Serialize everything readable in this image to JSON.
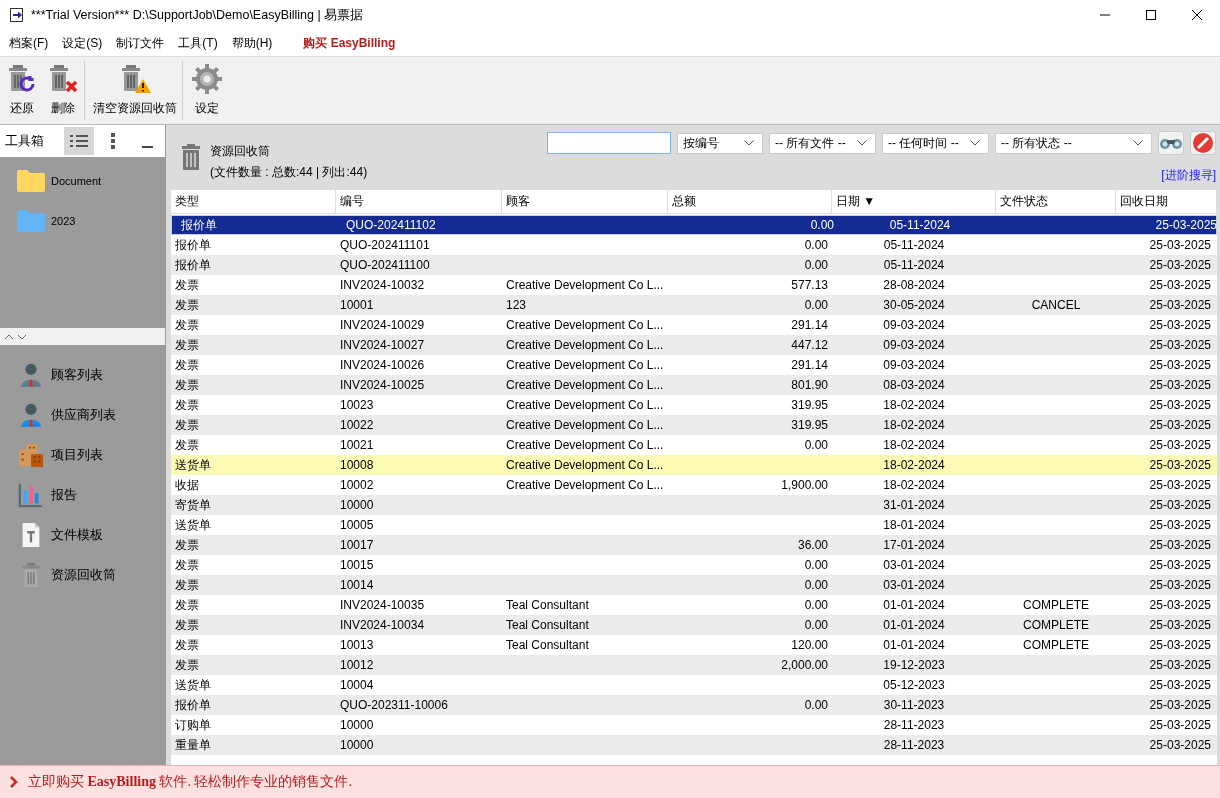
{
  "window": {
    "title": "***Trial Version*** D:\\SupportJob\\Demo\\EasyBilling | 易票据"
  },
  "menu": [
    "档案(F)",
    "设定(S)",
    "制订文件",
    "工具(T)",
    "帮助(H)"
  ],
  "buy_link": "购买 EasyBilling",
  "toolbar": [
    {
      "label": "还原",
      "kind": "restore"
    },
    {
      "label": "删除",
      "kind": "delete"
    },
    {
      "label": "清空资源回收筒",
      "kind": "empty"
    },
    {
      "label": "设定",
      "kind": "settings"
    }
  ],
  "toolbox": {
    "title": "工具箱",
    "views": [
      {
        "kind": "list",
        "selected": true
      },
      {
        "kind": "dots",
        "selected": false
      }
    ],
    "folders": [
      {
        "name": "Document",
        "color": "#ffd75e"
      },
      {
        "name": "2023",
        "color": "#64b5f6"
      }
    ],
    "nav": [
      {
        "label": "顾客列表",
        "kind": "customer"
      },
      {
        "label": "供应商列表",
        "kind": "supplier"
      },
      {
        "label": "项目列表",
        "kind": "project"
      },
      {
        "label": "报告",
        "kind": "report"
      },
      {
        "label": "文件模板",
        "kind": "template"
      },
      {
        "label": "资源回收筒",
        "kind": "bin"
      }
    ]
  },
  "panel": {
    "title": "资源回收筒",
    "count": "(文件数量 : 总数:44 | 列出:44)",
    "filters": [
      "按编号",
      "-- 所有文件 --",
      "-- 任何时间 --",
      "-- 所有状态 --"
    ],
    "advanced_link": "[进阶搜寻]"
  },
  "table": {
    "columns": [
      "类型",
      "编号",
      "顾客",
      "总额",
      "日期 ▼",
      "文件状态",
      "回收日期"
    ],
    "rows": [
      {
        "type": "报价单",
        "number": "QUO-202411102",
        "amount": "0.00",
        "date": "05-11-2024",
        "recycled": "25-03-2025",
        "selected": true,
        "highlighted": false
      },
      {
        "type": "报价单",
        "number": "QUO-202411101",
        "amount": "0.00",
        "date": "05-11-2024",
        "recycled": "25-03-2025",
        "selected": false,
        "highlighted": false
      },
      {
        "type": "报价单",
        "number": "QUO-202411100",
        "amount": "0.00",
        "date": "05-11-2024",
        "recycled": "25-03-2025",
        "selected": false,
        "highlighted": false
      },
      {
        "type": "发票",
        "number": "INV2024-10032",
        "customer": "Creative Development Co L...",
        "amount": "577.13",
        "date": "28-08-2024",
        "recycled": "25-03-2025",
        "selected": false,
        "highlighted": false
      },
      {
        "type": "发票",
        "number": "10001",
        "customer": "123",
        "amount": "0.00",
        "date": "30-05-2024",
        "status": "CANCEL",
        "recycled": "25-03-2025",
        "selected": false,
        "highlighted": false
      },
      {
        "type": "发票",
        "number": "INV2024-10029",
        "customer": "Creative Development Co L...",
        "amount": "291.14",
        "date": "09-03-2024",
        "recycled": "25-03-2025",
        "selected": false,
        "highlighted": false
      },
      {
        "type": "发票",
        "number": "INV2024-10027",
        "customer": "Creative Development Co L...",
        "amount": "447.12",
        "date": "09-03-2024",
        "recycled": "25-03-2025",
        "selected": false,
        "highlighted": false
      },
      {
        "type": "发票",
        "number": "INV2024-10026",
        "customer": "Creative Development Co L...",
        "amount": "291.14",
        "date": "09-03-2024",
        "recycled": "25-03-2025",
        "selected": false,
        "highlighted": false
      },
      {
        "type": "发票",
        "number": "INV2024-10025",
        "customer": "Creative Development Co L...",
        "amount": "801.90",
        "date": "08-03-2024",
        "recycled": "25-03-2025",
        "selected": false,
        "highlighted": false
      },
      {
        "type": "发票",
        "number": "10023",
        "customer": "Creative Development Co L...",
        "amount": "319.95",
        "date": "18-02-2024",
        "recycled": "25-03-2025",
        "selected": false,
        "highlighted": false
      },
      {
        "type": "发票",
        "number": "10022",
        "customer": "Creative Development Co L...",
        "amount": "319.95",
        "date": "18-02-2024",
        "recycled": "25-03-2025",
        "selected": false,
        "highlighted": false
      },
      {
        "type": "发票",
        "number": "10021",
        "customer": "Creative Development Co L...",
        "amount": "0.00",
        "date": "18-02-2024",
        "recycled": "25-03-2025",
        "selected": false,
        "highlighted": false
      },
      {
        "type": "送货单",
        "number": "10008",
        "customer": "Creative Development Co L...",
        "date": "18-02-2024",
        "recycled": "25-03-2025",
        "selected": false,
        "highlighted": true
      },
      {
        "type": "收据",
        "number": "10002",
        "customer": "Creative Development Co L...",
        "amount": "1,900.00",
        "date": "18-02-2024",
        "recycled": "25-03-2025",
        "selected": false,
        "highlighted": false
      },
      {
        "type": "寄货单",
        "number": "10000",
        "date": "31-01-2024",
        "recycled": "25-03-2025",
        "selected": false,
        "highlighted": false
      },
      {
        "type": "送货单",
        "number": "10005",
        "date": "18-01-2024",
        "recycled": "25-03-2025",
        "selected": false,
        "highlighted": false
      },
      {
        "type": "发票",
        "number": "10017",
        "amount": "36.00",
        "date": "17-01-2024",
        "recycled": "25-03-2025",
        "selected": false,
        "highlighted": false
      },
      {
        "type": "发票",
        "number": "10015",
        "amount": "0.00",
        "date": "03-01-2024",
        "recycled": "25-03-2025",
        "selected": false,
        "highlighted": false
      },
      {
        "type": "发票",
        "number": "10014",
        "amount": "0.00",
        "date": "03-01-2024",
        "recycled": "25-03-2025",
        "selected": false,
        "highlighted": false
      },
      {
        "type": "发票",
        "number": "INV2024-10035",
        "customer": "Teal Consultant",
        "amount": "0.00",
        "date": "01-01-2024",
        "status": "COMPLETE",
        "recycled": "25-03-2025",
        "selected": false,
        "highlighted": false
      },
      {
        "type": "发票",
        "number": "INV2024-10034",
        "customer": "Teal Consultant",
        "amount": "0.00",
        "date": "01-01-2024",
        "status": "COMPLETE",
        "recycled": "25-03-2025",
        "selected": false,
        "highlighted": false
      },
      {
        "type": "发票",
        "number": "10013",
        "customer": "Teal Consultant",
        "amount": "120.00",
        "date": "01-01-2024",
        "status": "COMPLETE",
        "recycled": "25-03-2025",
        "selected": false,
        "highlighted": false
      },
      {
        "type": "发票",
        "number": "10012",
        "amount": "2,000.00",
        "date": "19-12-2023",
        "recycled": "25-03-2025",
        "selected": false,
        "highlighted": false
      },
      {
        "type": "送货单",
        "number": "10004",
        "date": "05-12-2023",
        "recycled": "25-03-2025",
        "selected": false,
        "highlighted": false
      },
      {
        "type": "报价单",
        "number": "QUO-202311-10006",
        "amount": "0.00",
        "date": "30-11-2023",
        "recycled": "25-03-2025",
        "selected": false,
        "highlighted": false
      },
      {
        "type": "订购单",
        "number": "10000",
        "date": "28-11-2023",
        "recycled": "25-03-2025",
        "selected": false,
        "highlighted": false
      },
      {
        "type": "重量单",
        "number": "10000",
        "date": "28-11-2023",
        "recycled": "25-03-2025",
        "selected": false,
        "highlighted": false
      }
    ]
  },
  "banner": "立即购买 **EasyBilling** 软件. 轻松制作专业的销售文件."
}
